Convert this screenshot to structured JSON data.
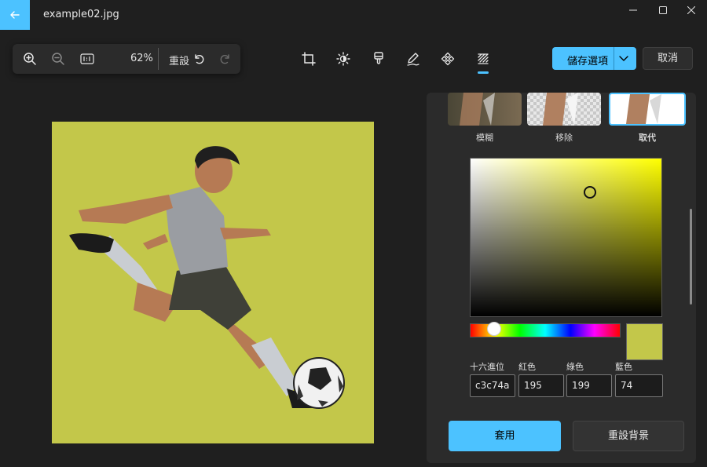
{
  "window": {
    "title": "example02.jpg"
  },
  "toolbar": {
    "zoom_percent": "62%",
    "reset_label": "重設",
    "save_options_label": "儲存選項",
    "cancel_label": "取消"
  },
  "background_panel": {
    "options": [
      {
        "label": "模糊"
      },
      {
        "label": "移除"
      },
      {
        "label": "取代"
      }
    ],
    "selected_option": "取代",
    "color_picker": {
      "hex_label": "十六進位",
      "hex_value": "c3c74a",
      "red_label": "紅色",
      "red_value": "195",
      "green_label": "綠色",
      "green_value": "199",
      "blue_label": "藍色",
      "blue_value": "74",
      "current_color": "#c3c74a",
      "hue_color": "#ffff00"
    },
    "apply_label": "套用",
    "reset_background_label": "重設背景"
  },
  "colors": {
    "accent": "#4cc2ff",
    "background": "#1f1f1f",
    "panel": "#2b2b2b",
    "replacement_background": "#c3c74a"
  }
}
